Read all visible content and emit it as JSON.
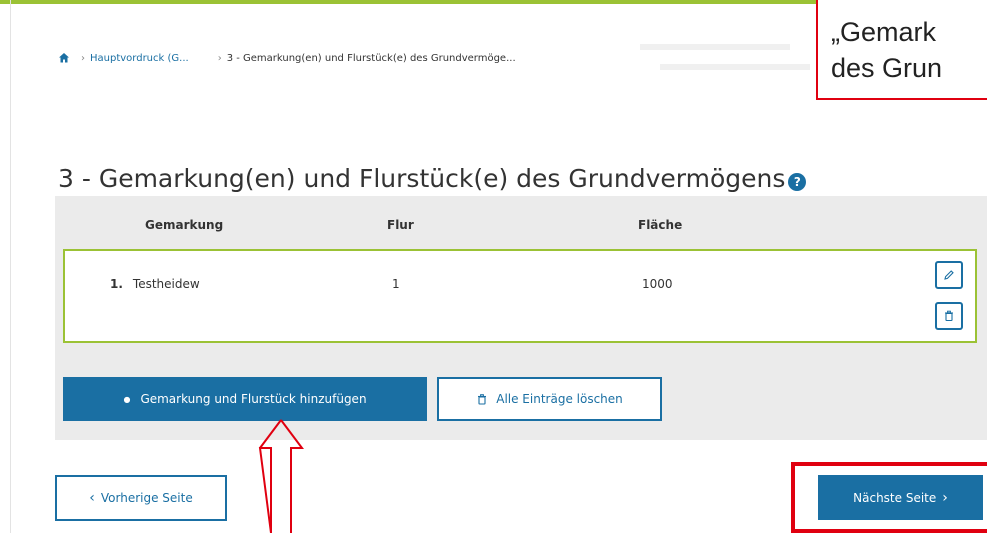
{
  "breadcrumb": {
    "home_icon": "home-icon",
    "items": [
      "Hauptvordruck (G...",
      "3 - Gemarkung(en) und Flurstück(e) des Grundvermöge..."
    ]
  },
  "callout": {
    "line1": "„Gemark",
    "line2": "des Grun"
  },
  "page": {
    "title": "3 - Gemarkung(en) und Flurstück(e) des Grundvermögens",
    "help_icon_glyph": "?"
  },
  "table": {
    "headers": [
      "Gemarkung",
      "Flur",
      "Fläche"
    ],
    "rows": [
      {
        "index": "1.",
        "gemarkung": "Testheidew",
        "flur": "1",
        "flaeche": "1000"
      }
    ]
  },
  "actions": {
    "add_label": "Gemarkung und Flurstück hinzufügen",
    "clear_label": "Alle Einträge löschen"
  },
  "nav": {
    "prev_label": "Vorherige Seite",
    "next_label": "Nächste Seite"
  },
  "colors": {
    "accent_green": "#9bc235",
    "primary_blue": "#1a6fa3",
    "annotation_red": "#e00010",
    "panel_gray": "#ebebeb"
  }
}
